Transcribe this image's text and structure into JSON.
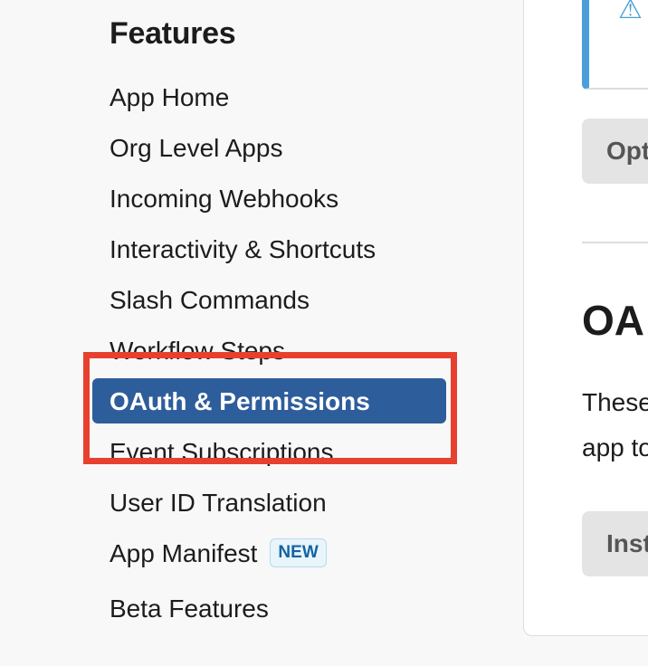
{
  "sidebar": {
    "section_title": "Features",
    "items": [
      {
        "label": "App Home"
      },
      {
        "label": "Org Level Apps"
      },
      {
        "label": "Incoming Webhooks"
      },
      {
        "label": "Interactivity & Shortcuts"
      },
      {
        "label": "Slash Commands"
      },
      {
        "label": "Workflow Steps"
      },
      {
        "label": "OAuth & Permissions",
        "active": true
      },
      {
        "label": "Event Subscriptions"
      },
      {
        "label": "User ID Translation"
      },
      {
        "label": "App Manifest",
        "badge": "NEW"
      },
      {
        "label": "Beta Features"
      }
    ]
  },
  "main": {
    "option_button_label": "Opt",
    "heading": "OA",
    "text_line1": "These",
    "text_line2": "app to",
    "install_button_label": "Inst"
  },
  "colors": {
    "active_item_bg": "#2e5d9b",
    "highlight_border": "#e8402e",
    "badge_text": "#1264a3"
  },
  "icons": {
    "warning": "warning-icon"
  }
}
